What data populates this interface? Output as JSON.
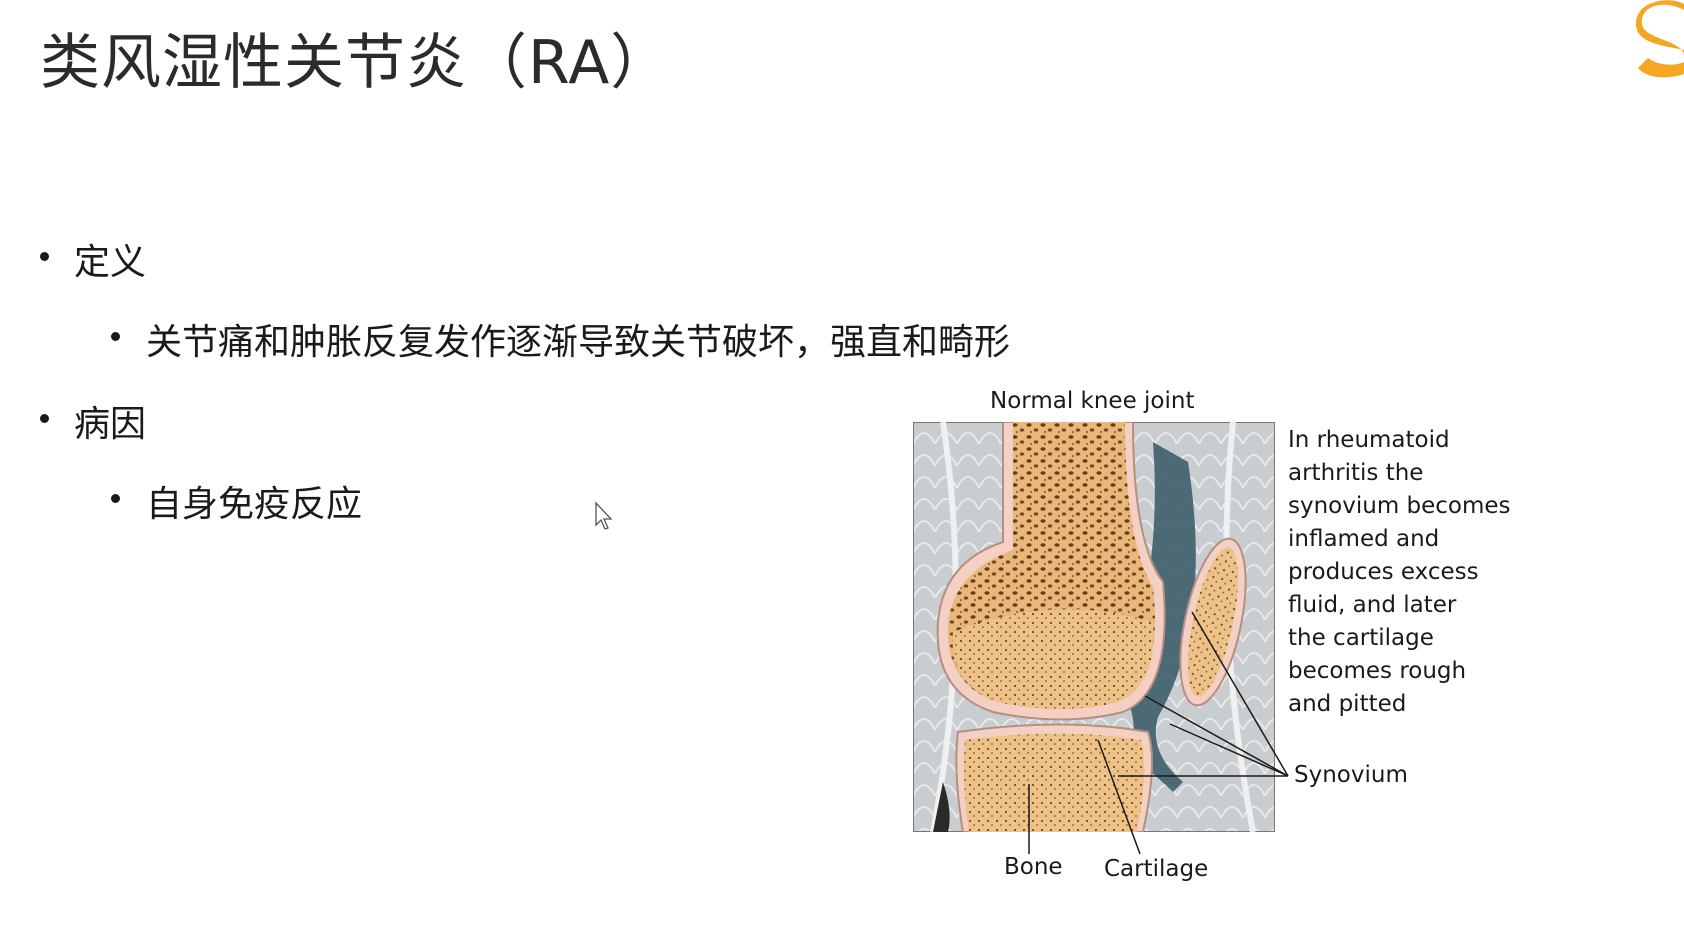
{
  "slide": {
    "title": "类风湿性关节炎（RA）",
    "bullets": [
      {
        "level": 1,
        "text": "定义"
      },
      {
        "level": 2,
        "text": "关节痛和肿胀反复发作逐渐导致关节破坏，强直和畸形"
      },
      {
        "level": 1,
        "text": "病因"
      },
      {
        "level": 2,
        "text": "自身免疫反应"
      }
    ]
  },
  "figure": {
    "heading": "Normal knee joint",
    "caption_lines": [
      "In rheumatoid",
      "arthritis the",
      "synovium becomes",
      "inflamed and",
      "produces excess",
      "fluid, and later",
      "the cartilage",
      "becomes rough",
      "and pitted"
    ],
    "labels": {
      "synovium": "Synovium",
      "bone": "Bone",
      "cartilage": "Cartilage"
    }
  },
  "colors": {
    "logo_orange": "#f5a623",
    "bone_fill": "#e8b77a",
    "bone_spots": "#6b3a1c",
    "cartilage": "#f4cfc3",
    "synovium": "#3d5f6b",
    "tissue_gray": "#c9cdd0"
  },
  "icons": {
    "cursor": "mouse-pointer-icon",
    "logo": "logo-fragment-icon"
  }
}
